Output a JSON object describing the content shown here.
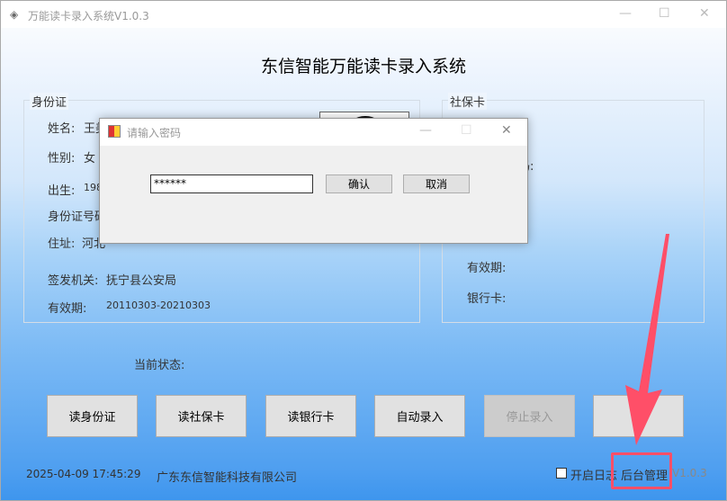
{
  "window": {
    "title": "万能读卡录入系统V1.0.3",
    "minimize": "—",
    "maximize": "☐",
    "close": "✕"
  },
  "heading": "东信智能万能读卡录入系统",
  "id_card": {
    "title": "身份证",
    "name_label": "姓名:",
    "name_value": "王美",
    "gender_label": "性别:",
    "gender_value": "女",
    "birth_label": "出生:",
    "birth_value": "198",
    "id_label": "身份证号码",
    "address_label": "住址:",
    "address_value": "河北",
    "issuer_label": "签发机关:",
    "issuer_value": "抚宁县公安局",
    "validity_label": "有效期:",
    "validity_value": "20110303-20210303"
  },
  "social_card": {
    "title": "社保卡",
    "partial_label": "码:",
    "validity_label": "有效期:",
    "bank_label": "银行卡:"
  },
  "status_label": "当前状态:",
  "buttons": [
    "读身份证",
    "读社保卡",
    "读银行卡",
    "自动录入",
    "停止录入",
    ""
  ],
  "footer": {
    "datetime": "2025-04-09 17:45:29",
    "company": "广东东信智能科技有限公司",
    "log_checkbox": "开启日志",
    "admin": "后台管理",
    "version": "V1.0.3",
    "log_checked": false
  },
  "dialog": {
    "title": "请输入密码",
    "password": "******",
    "confirm": "确认",
    "cancel": "取消",
    "minimize": "—",
    "maximize": "☐",
    "close": "✕"
  },
  "annotation_color": "#ff4f68"
}
